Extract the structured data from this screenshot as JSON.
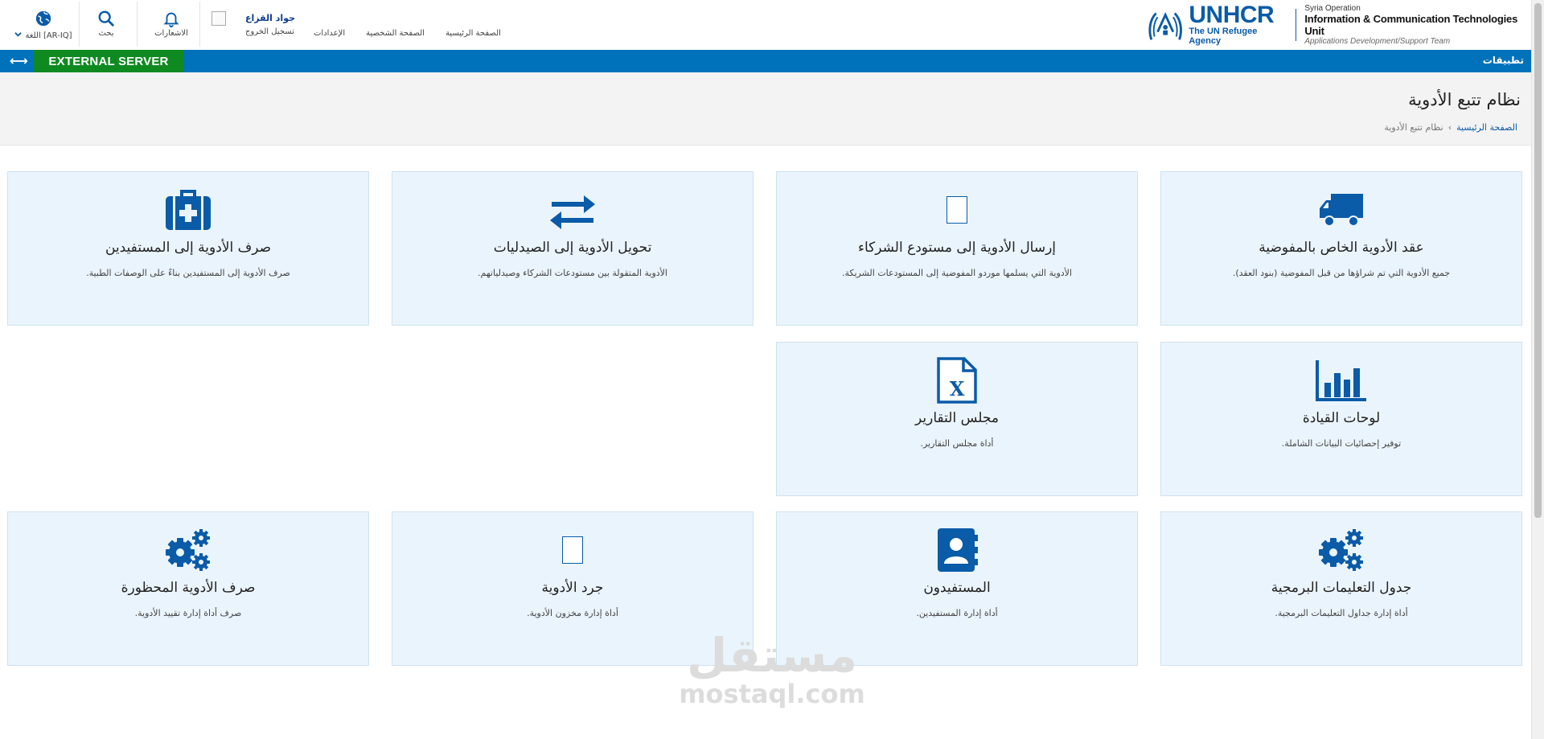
{
  "header": {
    "language_label": "اللغة [AR-IQ]",
    "search_label": "بحث",
    "notifications_label": "الاشعارات",
    "user_name": "جواد القزاع",
    "logout_label": "تسجيل الخروج",
    "nav": [
      "الإعدادات",
      "الصفحة الشخصية",
      "الصفحة الرئيسية"
    ],
    "logo": {
      "brand": "UNHCR",
      "agency": "The UN Refugee Agency",
      "operation": "Syria Operation",
      "unit": "Information & Communication Technologies Unit",
      "team": "Applications Development/Support Team"
    }
  },
  "bar": {
    "server_label": "EXTERNAL SERVER",
    "apps_label": "تطبيقات",
    "expand_icon": "⟷"
  },
  "page": {
    "title": "نظام تتبع الأدوية",
    "breadcrumb_home": "الصفحة الرئيسية",
    "breadcrumb_sep": "›",
    "breadcrumb_current": "نظام تتبع الأدوية"
  },
  "tiles": [
    {
      "title": "عقد الأدوية الخاص بالمفوضية",
      "desc": "جميع الأدوية التي تم شراؤها من قبل المفوضية (بنود العقد).",
      "icon": "truck-icon"
    },
    {
      "title": "إرسال الأدوية إلى مستودع الشركاء",
      "desc": "الأدوية التي يسلمها موردو المفوضية إلى المستودعات الشريكة.",
      "icon": "broken-image-icon"
    },
    {
      "title": "تحويل الأدوية إلى الصيدليات",
      "desc": "الأدوية المتقولة بين مستودعات الشركاء وصيدلياتهم.",
      "icon": "exchange-icon"
    },
    {
      "title": "صرف الأدوية إلى المستفيدين",
      "desc": "صرف الأدوية إلى المستفيدين بناءً على الوصفات الطبية.",
      "icon": "medkit-icon"
    },
    {
      "title": "لوحات القيادة",
      "desc": "توفير إحصائيات البيانات الشاملة.",
      "icon": "bar-chart-icon"
    },
    {
      "title": "مجلس التقارير",
      "desc": "أداة مجلس التقارير.",
      "icon": "excel-file-icon"
    },
    {
      "title": "جدول التعليمات البرمجية",
      "desc": "أداة إدارة جداول التعليمات البرمجية.",
      "icon": "gears-icon"
    },
    {
      "title": "المستفيدون",
      "desc": "أداة إدارة المستفيدين.",
      "icon": "address-book-icon"
    },
    {
      "title": "جرد الأدوية",
      "desc": "أداة إدارة مخزون الأدوية.",
      "icon": "broken-image-icon"
    },
    {
      "title": "صرف الأدوية المحظورة",
      "desc": "صرف أداة إدارة تقييد الأدوية.",
      "icon": "gears-icon"
    }
  ],
  "watermark": {
    "arabic": "مستقل",
    "latin": "mostaql.com"
  },
  "colors": {
    "primary": "#0072bc",
    "server_green": "#0f8a20",
    "tile_bg": "#eaf4fc",
    "icon_blue": "#0a5ba8"
  }
}
